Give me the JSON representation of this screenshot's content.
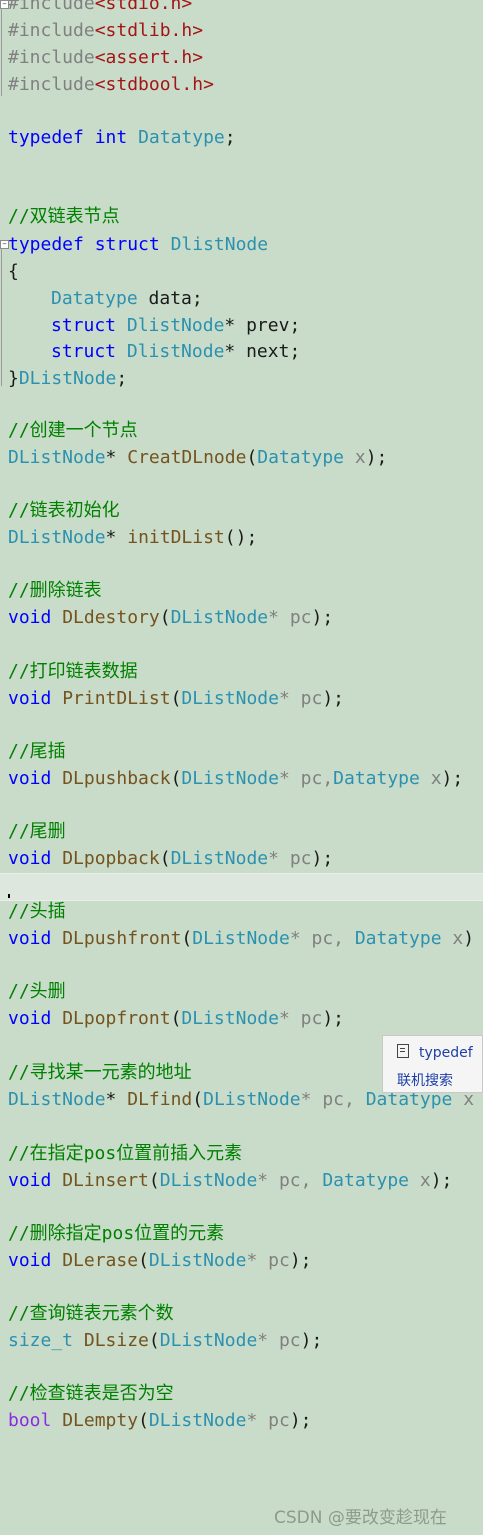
{
  "editor": {
    "includes": [
      {
        "directive": "#include",
        "header": "<stdio.h>"
      },
      {
        "directive": "#include",
        "header": "<stdlib.h>"
      },
      {
        "directive": "#include",
        "header": "<assert.h>"
      },
      {
        "directive": "#include",
        "header": "<stdbool.h>"
      }
    ],
    "typedef_int": {
      "kw1": "typedef",
      "kw2": "int",
      "name": "Datatype",
      "end": ";"
    },
    "struct_block": {
      "comment": "//双链表节点",
      "head_kw": "typedef struct",
      "head_name": "DlistNode",
      "open": "{",
      "field1": {
        "type": "Datatype",
        "rest": " data;"
      },
      "field2": {
        "kw": "struct",
        "type": "DlistNode",
        "rest": "* prev;"
      },
      "field3": {
        "kw": "struct",
        "type": "DlistNode",
        "rest": "* next;"
      },
      "close": "}",
      "close_name": "DListNode",
      "close_end": ";"
    },
    "decls": [
      {
        "comment": "//创建一个节点",
        "ret": "DListNode",
        "ret_suffix": "* ",
        "fn": "CreatDLnode",
        "p1": "(",
        "ptype": "Datatype",
        "pname": " x",
        "tail": ");"
      },
      {
        "comment": "//链表初始化",
        "ret": "DListNode",
        "ret_suffix": "* ",
        "fn": "initDList",
        "p1": "",
        "ptype": "",
        "pname": "",
        "tail": "();"
      },
      {
        "comment": "//删除链表",
        "ret": "void",
        "ret_suffix": " ",
        "fn": "DLdestory",
        "p1": "(",
        "ptype": "DListNode",
        "pname": "* pc",
        "tail": ");"
      },
      {
        "comment": "//打印链表数据",
        "ret": "void",
        "ret_suffix": " ",
        "fn": "PrintDList",
        "p1": "(",
        "ptype": "DListNode",
        "pname": "* pc",
        "tail": ");"
      },
      {
        "comment": "//尾插",
        "ret": "void",
        "ret_suffix": " ",
        "fn": "DLpushback",
        "p1": "(",
        "ptype": "DListNode",
        "pname": "* pc,",
        "ptype2": "Datatype",
        "pname2": " x",
        "tail": ");"
      },
      {
        "comment": "//尾删",
        "ret": "void",
        "ret_suffix": " ",
        "fn": "DLpopback",
        "p1": "(",
        "ptype": "DListNode",
        "pname": "* pc",
        "tail": ");"
      },
      {
        "comment": "//头插",
        "ret": "void",
        "ret_suffix": " ",
        "fn": "DLpushfront",
        "p1": "(",
        "ptype": "DListNode",
        "pname": "* pc, ",
        "ptype2": "Datatype",
        "pname2": " x",
        "tail": ")"
      },
      {
        "comment": "//头删",
        "ret": "void",
        "ret_suffix": " ",
        "fn": "DLpopfront",
        "p1": "(",
        "ptype": "DListNode",
        "pname": "* pc",
        "tail": ");"
      },
      {
        "comment": "//寻找某一元素的地址",
        "ret": "DListNode",
        "ret_suffix": "* ",
        "fn": "DLfind",
        "p1": "(",
        "ptype": "DListNode",
        "pname": "* pc, ",
        "ptype2": "Datatype",
        "pname2": " x",
        "tail": ""
      },
      {
        "comment": "//在指定pos位置前插入元素",
        "ret": "void",
        "ret_suffix": " ",
        "fn": "DLinsert",
        "p1": "(",
        "ptype": "DListNode",
        "pname": "* pc, ",
        "ptype2": "Datatype",
        "pname2": " x",
        "tail": ");"
      },
      {
        "comment": "//删除指定pos位置的元素",
        "ret": "void",
        "ret_suffix": " ",
        "fn": "DLerase",
        "p1": "(",
        "ptype": "DListNode",
        "pname": "* pc",
        "tail": ");"
      },
      {
        "comment": "//查询链表元素个数",
        "ret": "size_t",
        "ret_suffix": " ",
        "fn": "DLsize",
        "p1": "(",
        "ptype": "DListNode",
        "pname": "* pc",
        "tail": ");"
      },
      {
        "comment": "//检查链表是否为空",
        "ret": "bool",
        "ret_suffix": " ",
        "fn": "DLempty",
        "p1": "(",
        "ptype": "DListNode",
        "pname": "* pc",
        "tail": ");"
      }
    ]
  },
  "popup": {
    "item_icon": "document-icon",
    "item_label": "typedef",
    "search_label": "联机搜索"
  },
  "watermark": "CSDN @要改变趁现在",
  "colors": {
    "keyword": "#0000ff",
    "type": "#2b91af",
    "function": "#74531f",
    "comment": "#008000",
    "background": "#c9dcc9"
  }
}
